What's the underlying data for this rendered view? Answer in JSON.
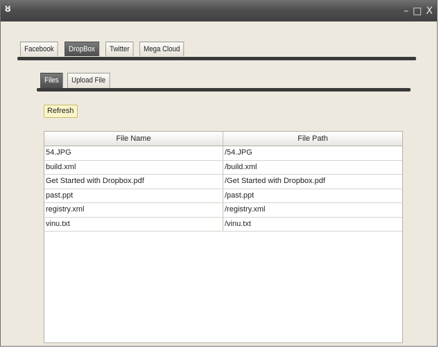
{
  "window": {
    "icon": "app-icon",
    "controls": [
      "–",
      "□",
      "X"
    ]
  },
  "outer_tabs": [
    {
      "label": "Facebook",
      "active": false
    },
    {
      "label": "DropBox",
      "active": true
    },
    {
      "label": "Twitter",
      "active": false
    },
    {
      "label": "Mega Cloud",
      "active": false
    }
  ],
  "inner_tabs": [
    {
      "label": "Files",
      "active": true
    },
    {
      "label": "Upload File",
      "active": false
    }
  ],
  "refresh_label": "Refresh",
  "table": {
    "columns": [
      "File Name",
      "File Path"
    ],
    "rows": [
      [
        "54.JPG",
        "/54.JPG"
      ],
      [
        "build.xml",
        "/build.xml"
      ],
      [
        "Get Started with Dropbox.pdf",
        "/Get Started with Dropbox.pdf"
      ],
      [
        "past.ppt",
        "/past.ppt"
      ],
      [
        "registry.xml",
        "/registry.xml"
      ],
      [
        "vinu.txt",
        "/vinu.txt"
      ]
    ]
  }
}
